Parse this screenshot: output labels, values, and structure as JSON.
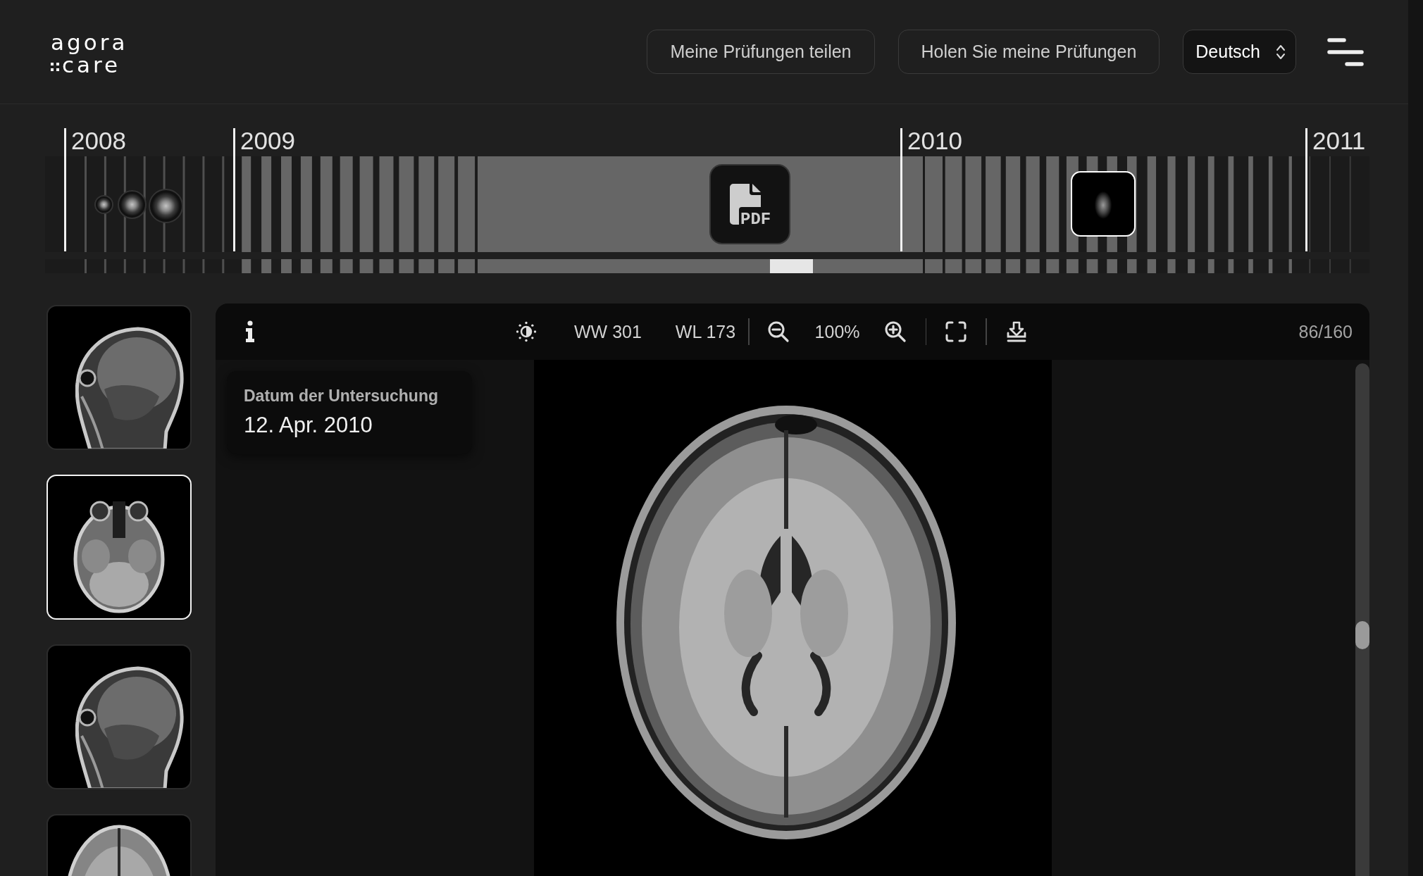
{
  "header": {
    "logo": {
      "line_1": "agora",
      "line_2": "care"
    },
    "buttons": [
      "Meine Prüfungen teilen",
      "Holen Sie meine Prüfungen"
    ],
    "language": {
      "value": "Deutsch"
    }
  },
  "timeline": {
    "years": [
      "2008",
      "2009",
      "2010",
      "2011"
    ],
    "items": [
      {
        "kind": "dot",
        "selected": false
      },
      {
        "kind": "dot",
        "selected": false
      },
      {
        "kind": "dot",
        "selected": false
      },
      {
        "kind": "pdf",
        "label": "PDF",
        "selected": false
      },
      {
        "kind": "tile",
        "selected": true
      }
    ]
  },
  "thumbnails": [
    {
      "kind": "sagittal",
      "selected": false
    },
    {
      "kind": "axial",
      "selected": true
    },
    {
      "kind": "sagittal",
      "selected": false
    },
    {
      "kind": "coronal",
      "selected": false
    }
  ],
  "viewer": {
    "toolbar": {
      "window_width": "WW 301",
      "window_level": "WL 173",
      "zoom": "100%",
      "slice": "86/160"
    },
    "info_card": {
      "label": "Datum der Untersuchung",
      "value": "12. Apr. 2010"
    }
  }
}
